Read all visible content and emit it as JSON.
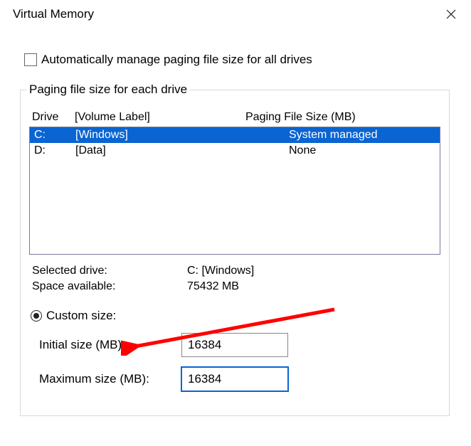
{
  "window": {
    "title": "Virtual Memory"
  },
  "auto": {
    "label": "Automatically manage paging file size for all drives",
    "checked": false
  },
  "group": {
    "legend": "Paging file size for each drive",
    "headers": {
      "drive": "Drive",
      "label": "[Volume Label]",
      "pfs": "Paging File Size (MB)"
    },
    "rows": [
      {
        "drive": "C:",
        "label": "[Windows]",
        "pfs": "System managed",
        "selected": true
      },
      {
        "drive": "D:",
        "label": "[Data]",
        "pfs": "None",
        "selected": false
      }
    ]
  },
  "info": {
    "selected_label": "Selected drive:",
    "selected_value": "C:  [Windows]",
    "space_label": "Space available:",
    "space_value": "75432 MB"
  },
  "custom": {
    "radio_label": "Custom size:",
    "initial_label": "Initial size (MB):",
    "initial_value": "16384",
    "maximum_label": "Maximum size (MB):",
    "maximum_value": "16384"
  },
  "arrow": {
    "color": "#ff0000"
  }
}
